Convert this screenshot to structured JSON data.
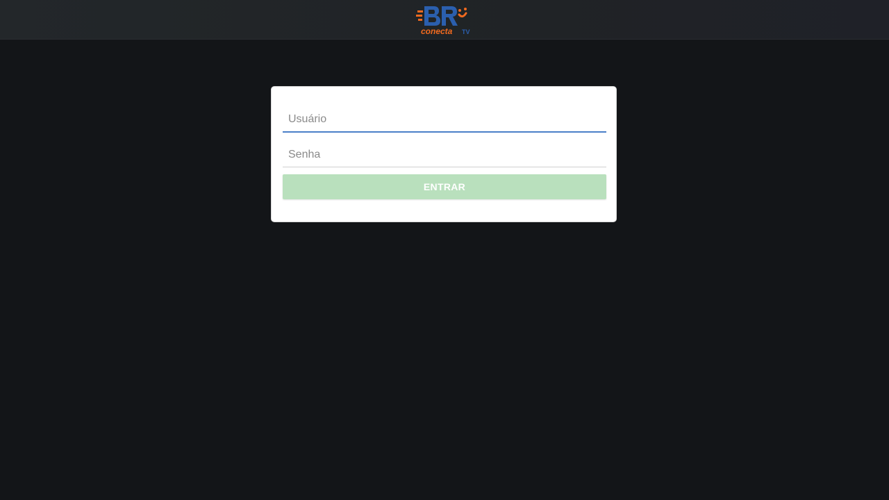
{
  "header": {
    "logo": {
      "icon": "brand-logo",
      "brand_text": "BR",
      "sub_text": "conecta",
      "tv_text": "TV",
      "colors": {
        "blue": "#2b5fae",
        "orange": "#f06a1f"
      }
    }
  },
  "login": {
    "username": {
      "value": "",
      "placeholder": "Usuário"
    },
    "password": {
      "value": "",
      "placeholder": "Senha"
    },
    "submit_label": "ENTRAR"
  },
  "theme": {
    "background": "#131518",
    "header_bg": "#23272a",
    "card_bg": "#ffffff",
    "focus_line": "#4a7fc8",
    "button_bg": "#b9e0bd"
  }
}
